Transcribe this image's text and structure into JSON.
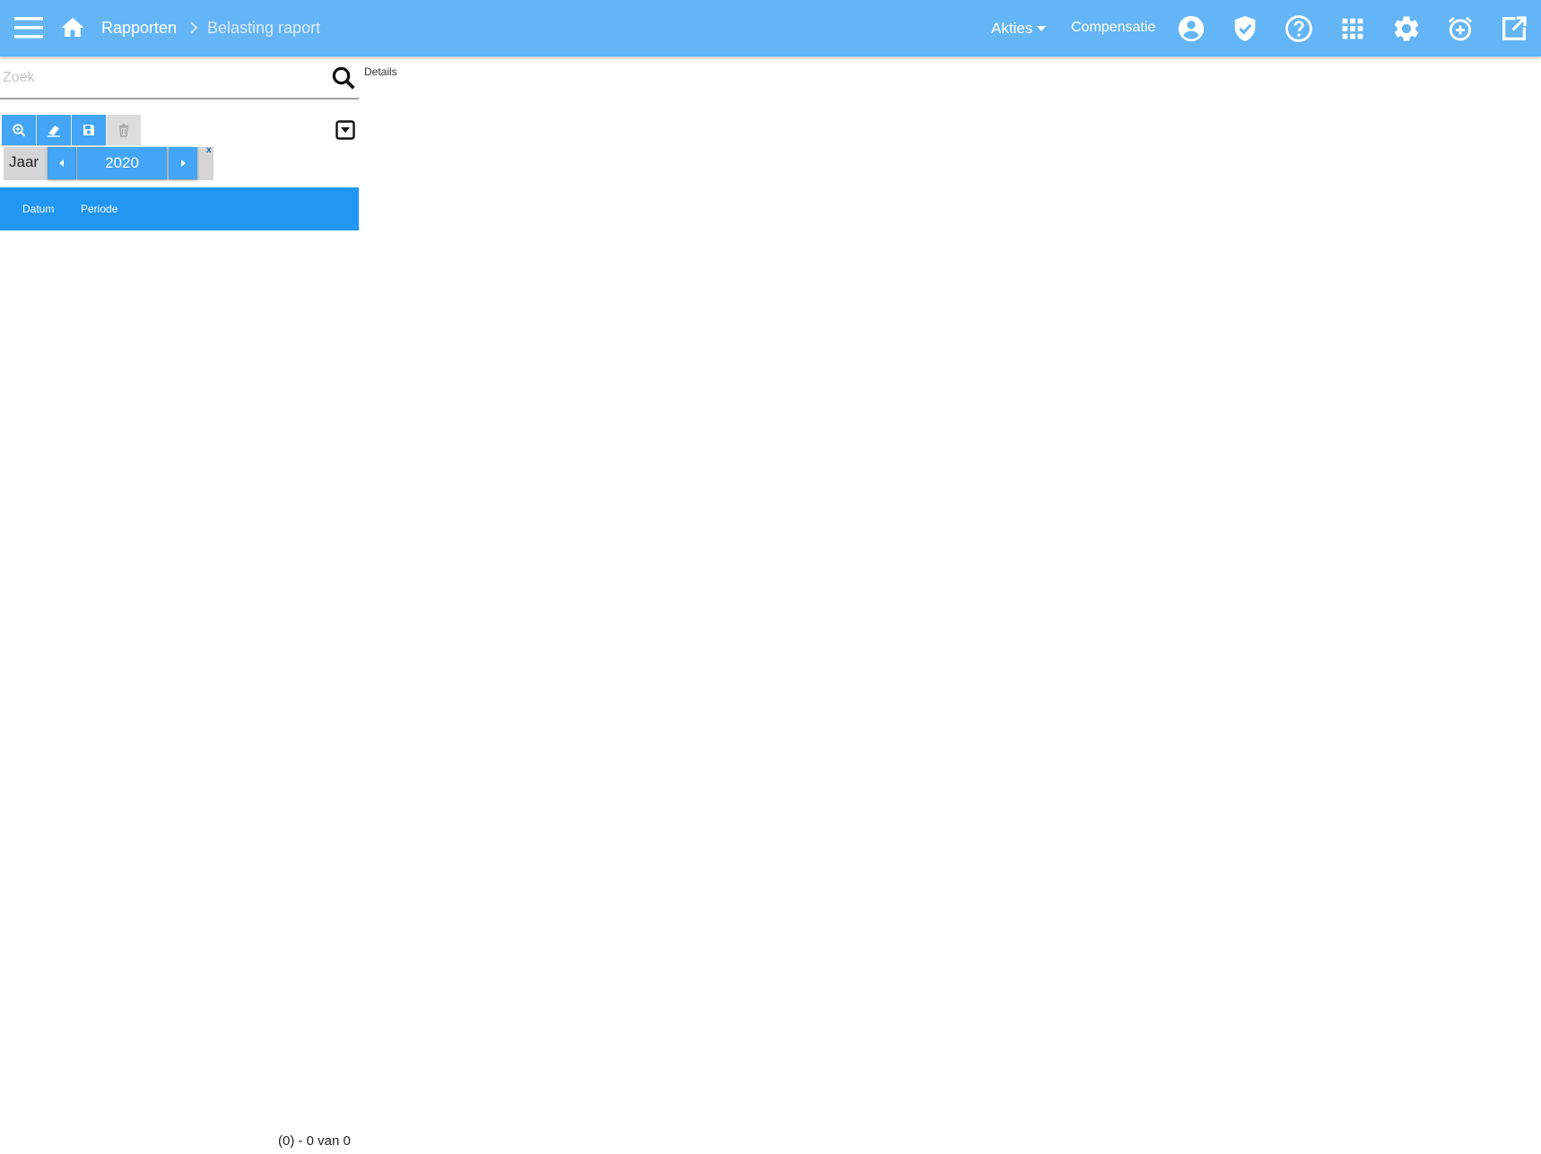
{
  "header": {
    "breadcrumb": {
      "parent": "Rapporten",
      "current": "Belasting raport"
    },
    "akties_label": "Akties",
    "compensatie_label": "Compensatie",
    "icons": [
      "menu-icon",
      "home-icon",
      "account-circle-icon",
      "shield-check-icon",
      "help-circle-icon",
      "apps-grid-icon",
      "settings-gear-icon",
      "alarm-plus-icon",
      "open-in-new-icon"
    ],
    "bar_color": "#64b5f6"
  },
  "search": {
    "placeholder": "Zoek",
    "value": ""
  },
  "details_label": "Details",
  "toolbar": {
    "buttons": [
      "zoom-icon",
      "eraser-icon",
      "save-icon",
      "delete-icon"
    ],
    "delete_disabled": true,
    "button_color": "#42a5f5"
  },
  "year_filter": {
    "label": "Jaar",
    "value": "2020",
    "close_label": "x"
  },
  "table": {
    "columns": [
      "Datum",
      "Periode"
    ],
    "rows": [],
    "header_color": "#2196f3"
  },
  "pager": {
    "text": "(0) - 0 van 0"
  }
}
